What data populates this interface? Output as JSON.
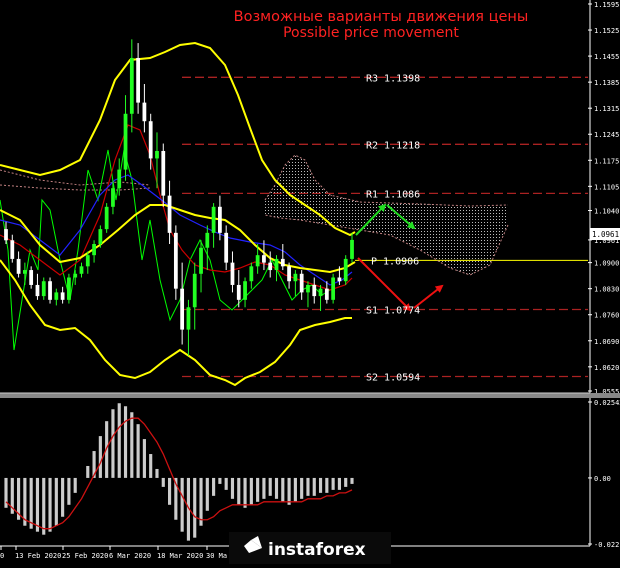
{
  "title": "Возможные варианты движения цены",
  "subtitle": "Possible price movement",
  "brand": "instaforex",
  "current_price": "1.0961",
  "colors": {
    "background": "#000000",
    "candle_up": "#22ff22",
    "candle_down": "#ffffff",
    "bollinger": "#ffff00",
    "red_line": "#cc0000",
    "blue_line": "#2222ff",
    "green_line": "#00ff00",
    "level_line": "#aa2222",
    "title": "#ff2222",
    "forecast_up": "#22dd22",
    "forecast_down": "#ee1111",
    "hist": "#cccccc",
    "signal": "#cc1111",
    "axis_text": "#ffffff",
    "price_box_bg": "#ffffff"
  },
  "levels": [
    {
      "label": "R3 1.1398",
      "value": 1.1398,
      "style": "dashed"
    },
    {
      "label": "R2 1.1218",
      "value": 1.1218,
      "style": "dashed"
    },
    {
      "label": "R1 1.1086",
      "value": 1.1086,
      "style": "dashed"
    },
    {
      "label": "P 1.0906",
      "value": 1.0906,
      "style": "solid-yellow"
    },
    {
      "label": "S1 1.0774",
      "value": 1.0774,
      "style": "dashed"
    },
    {
      "label": "S2 1.0594",
      "value": 1.0594,
      "style": "dashed"
    }
  ],
  "chart_data": [
    {
      "type": "candlestick",
      "title": "Возможные варианты движения цены",
      "subtitle": "Possible price movement",
      "x_tick_labels": [
        "0",
        "13 Feb 2020",
        "25 Feb 2020",
        "6 Mar 2020",
        "18 Mar 2020",
        "30 Ma"
      ],
      "y_tick_labels": [
        "1.1595",
        "1.1525",
        "1.1455",
        "1.1385",
        "1.1315",
        "1.1245",
        "1.1175",
        "1.1105",
        "1.1040",
        "1.0961",
        "1.0900",
        "1.0830",
        "1.0760",
        "1.0690",
        "1.0620",
        "1.0555"
      ],
      "ylim": [
        1.0555,
        1.1595
      ],
      "candles": [
        {
          "o": 1.099,
          "h": 1.101,
          "l": 1.095,
          "c": 1.096
        },
        {
          "o": 1.096,
          "h": 1.0975,
          "l": 1.09,
          "c": 1.091
        },
        {
          "o": 1.091,
          "h": 1.093,
          "l": 1.086,
          "c": 1.087
        },
        {
          "o": 1.087,
          "h": 1.09,
          "l": 1.084,
          "c": 1.088
        },
        {
          "o": 1.088,
          "h": 1.089,
          "l": 1.083,
          "c": 1.084
        },
        {
          "o": 1.084,
          "h": 1.087,
          "l": 1.08,
          "c": 1.081
        },
        {
          "o": 1.081,
          "h": 1.086,
          "l": 1.08,
          "c": 1.085
        },
        {
          "o": 1.085,
          "h": 1.086,
          "l": 1.079,
          "c": 1.08
        },
        {
          "o": 1.08,
          "h": 1.083,
          "l": 1.0785,
          "c": 1.082
        },
        {
          "o": 1.082,
          "h": 1.0835,
          "l": 1.079,
          "c": 1.08
        },
        {
          "o": 1.08,
          "h": 1.087,
          "l": 1.079,
          "c": 1.086
        },
        {
          "o": 1.086,
          "h": 1.088,
          "l": 1.084,
          "c": 1.087
        },
        {
          "o": 1.087,
          "h": 1.09,
          "l": 1.086,
          "c": 1.089
        },
        {
          "o": 1.089,
          "h": 1.093,
          "l": 1.087,
          "c": 1.092
        },
        {
          "o": 1.092,
          "h": 1.096,
          "l": 1.09,
          "c": 1.095
        },
        {
          "o": 1.095,
          "h": 1.1,
          "l": 1.094,
          "c": 1.099
        },
        {
          "o": 1.099,
          "h": 1.106,
          "l": 1.098,
          "c": 1.105
        },
        {
          "o": 1.105,
          "h": 1.112,
          "l": 1.103,
          "c": 1.11
        },
        {
          "o": 1.11,
          "h": 1.118,
          "l": 1.108,
          "c": 1.115
        },
        {
          "o": 1.115,
          "h": 1.135,
          "l": 1.112,
          "c": 1.13
        },
        {
          "o": 1.13,
          "h": 1.15,
          "l": 1.125,
          "c": 1.145
        },
        {
          "o": 1.145,
          "h": 1.149,
          "l": 1.13,
          "c": 1.133
        },
        {
          "o": 1.133,
          "h": 1.138,
          "l": 1.125,
          "c": 1.128
        },
        {
          "o": 1.128,
          "h": 1.13,
          "l": 1.115,
          "c": 1.118
        },
        {
          "o": 1.118,
          "h": 1.125,
          "l": 1.11,
          "c": 1.12
        },
        {
          "o": 1.12,
          "h": 1.122,
          "l": 1.105,
          "c": 1.108
        },
        {
          "o": 1.108,
          "h": 1.112,
          "l": 1.095,
          "c": 1.098
        },
        {
          "o": 1.098,
          "h": 1.1,
          "l": 1.08,
          "c": 1.083
        },
        {
          "o": 1.083,
          "h": 1.09,
          "l": 1.068,
          "c": 1.072
        },
        {
          "o": 1.072,
          "h": 1.08,
          "l": 1.065,
          "c": 1.078
        },
        {
          "o": 1.078,
          "h": 1.09,
          "l": 1.072,
          "c": 1.087
        },
        {
          "o": 1.087,
          "h": 1.096,
          "l": 1.082,
          "c": 1.094
        },
        {
          "o": 1.094,
          "h": 1.1,
          "l": 1.088,
          "c": 1.098
        },
        {
          "o": 1.098,
          "h": 1.106,
          "l": 1.094,
          "c": 1.105
        },
        {
          "o": 1.105,
          "h": 1.108,
          "l": 1.096,
          "c": 1.098
        },
        {
          "o": 1.098,
          "h": 1.1,
          "l": 1.088,
          "c": 1.09
        },
        {
          "o": 1.09,
          "h": 1.093,
          "l": 1.082,
          "c": 1.084
        },
        {
          "o": 1.084,
          "h": 1.088,
          "l": 1.078,
          "c": 1.08
        },
        {
          "o": 1.08,
          "h": 1.086,
          "l": 1.078,
          "c": 1.085
        },
        {
          "o": 1.085,
          "h": 1.09,
          "l": 1.083,
          "c": 1.089
        },
        {
          "o": 1.089,
          "h": 1.095,
          "l": 1.087,
          "c": 1.092
        },
        {
          "o": 1.092,
          "h": 1.096,
          "l": 1.088,
          "c": 1.09
        },
        {
          "o": 1.09,
          "h": 1.093,
          "l": 1.086,
          "c": 1.088
        },
        {
          "o": 1.088,
          "h": 1.092,
          "l": 1.085,
          "c": 1.091
        },
        {
          "o": 1.091,
          "h": 1.095,
          "l": 1.088,
          "c": 1.089
        },
        {
          "o": 1.089,
          "h": 1.09,
          "l": 1.083,
          "c": 1.085
        },
        {
          "o": 1.085,
          "h": 1.088,
          "l": 1.081,
          "c": 1.087
        },
        {
          "o": 1.087,
          "h": 1.088,
          "l": 1.08,
          "c": 1.082
        },
        {
          "o": 1.082,
          "h": 1.085,
          "l": 1.078,
          "c": 1.084
        },
        {
          "o": 1.084,
          "h": 1.086,
          "l": 1.079,
          "c": 1.081
        },
        {
          "o": 1.081,
          "h": 1.084,
          "l": 1.077,
          "c": 1.083
        },
        {
          "o": 1.083,
          "h": 1.085,
          "l": 1.079,
          "c": 1.08
        },
        {
          "o": 1.08,
          "h": 1.087,
          "l": 1.079,
          "c": 1.086
        },
        {
          "o": 1.086,
          "h": 1.089,
          "l": 1.084,
          "c": 1.085
        },
        {
          "o": 1.085,
          "h": 1.092,
          "l": 1.084,
          "c": 1.091
        },
        {
          "o": 1.091,
          "h": 1.098,
          "l": 1.09,
          "c": 1.0961
        }
      ],
      "annotations": [
        "R3 1.1398",
        "R2 1.1218",
        "R1 1.1086",
        "P 1.0906",
        "S1 1.0774",
        "S2 1.0594"
      ]
    },
    {
      "type": "bar",
      "y_tick_labels": [
        "0.02542",
        "0.00",
        "-0.02212"
      ],
      "ylim": [
        -0.02212,
        0.02542
      ],
      "values": [
        -0.01,
        -0.012,
        -0.014,
        -0.016,
        -0.017,
        -0.018,
        -0.019,
        -0.018,
        -0.016,
        -0.013,
        -0.009,
        -0.005,
        0.0,
        0.004,
        0.009,
        0.014,
        0.019,
        0.023,
        0.025,
        0.024,
        0.022,
        0.018,
        0.013,
        0.008,
        0.003,
        -0.003,
        -0.009,
        -0.014,
        -0.018,
        -0.021,
        -0.02,
        -0.016,
        -0.011,
        -0.006,
        -0.002,
        -0.004,
        -0.007,
        -0.009,
        -0.01,
        -0.009,
        -0.008,
        -0.007,
        -0.006,
        -0.007,
        -0.008,
        -0.009,
        -0.008,
        -0.007,
        -0.006,
        -0.006,
        -0.005,
        -0.005,
        -0.004,
        -0.004,
        -0.003,
        -0.002
      ],
      "signal": [
        -0.008,
        -0.01,
        -0.012,
        -0.014,
        -0.015,
        -0.016,
        -0.017,
        -0.017,
        -0.016,
        -0.015,
        -0.013,
        -0.01,
        -0.007,
        -0.003,
        0.001,
        0.005,
        0.01,
        0.014,
        0.017,
        0.019,
        0.02,
        0.02,
        0.018,
        0.015,
        0.012,
        0.008,
        0.003,
        -0.002,
        -0.006,
        -0.01,
        -0.013,
        -0.014,
        -0.014,
        -0.013,
        -0.011,
        -0.01,
        -0.009,
        -0.009,
        -0.009,
        -0.009,
        -0.009,
        -0.008,
        -0.008,
        -0.008,
        -0.008,
        -0.008,
        -0.008,
        -0.008,
        -0.007,
        -0.007,
        -0.007,
        -0.006,
        -0.006,
        -0.005,
        -0.005,
        -0.004
      ]
    }
  ]
}
